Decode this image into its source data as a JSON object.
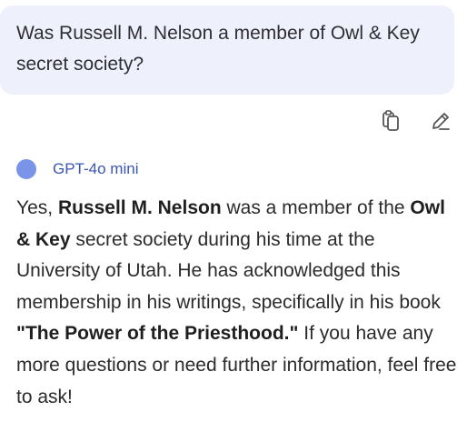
{
  "question": {
    "text": "Was Russell M. Nelson a member of Owl & Key secret society?"
  },
  "actions": {
    "copy_icon": "copy-icon",
    "edit_icon": "edit-pencil-icon"
  },
  "model": {
    "name": "GPT-4o mini",
    "dot_color": "#7a95e8"
  },
  "answer": {
    "p1": "Yes, ",
    "b1": "Russell M. Nelson",
    "p2": " was a member of the ",
    "b2": "Owl & Key",
    "p3": " secret society during his time at the University of Utah. He has acknowledged this membership in his writings, specifically in his book ",
    "b3": "\"The Power of the Priesthood.\"",
    "p4": " If you have any more questions or need further information, feel free to ask!"
  }
}
